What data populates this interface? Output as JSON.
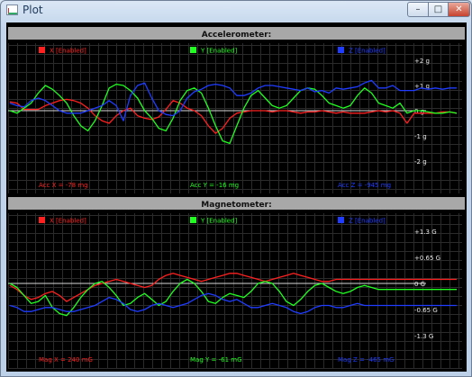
{
  "window": {
    "title": "Plot",
    "min_label": "–",
    "max_label": "□",
    "close_label": "✕"
  },
  "chart_data": [
    {
      "type": "line",
      "title": "Accelerometer:",
      "series": [
        {
          "name": "X [Enabled]",
          "color": "#ff2020",
          "values": [
            0.35,
            0.3,
            0.05,
            0.05,
            0.05,
            0.2,
            0.3,
            0.4,
            0.45,
            0.4,
            0.3,
            0.1,
            -0.2,
            -0.4,
            -0.5,
            -0.2,
            0.0,
            0.1,
            -0.2,
            -0.3,
            -0.35,
            -0.25,
            0.05,
            0.4,
            0.3,
            0.1,
            0.0,
            -0.2,
            -0.6,
            -0.9,
            -0.7,
            -0.3,
            -0.1,
            -0.05,
            0.0,
            0.0,
            0.0,
            -0.05,
            0.0,
            0.0,
            -0.05,
            -0.1,
            -0.05,
            -0.05,
            0.0,
            -0.05,
            -0.1,
            -0.05,
            -0.1,
            -0.1,
            -0.1,
            -0.05,
            0.0,
            -0.05,
            0.0,
            -0.1,
            -0.5,
            -0.1,
            -0.1,
            -0.1,
            -0.1,
            -0.05,
            -0.05,
            -0.1
          ]
        },
        {
          "name": "Y [Enabled]",
          "color": "#20ff20",
          "values": [
            0.0,
            -0.1,
            0.1,
            0.3,
            0.7,
            1.0,
            0.85,
            0.6,
            0.3,
            -0.2,
            -0.6,
            -0.8,
            -0.4,
            0.2,
            0.9,
            1.05,
            1.0,
            0.8,
            0.5,
            0.0,
            -0.3,
            -0.7,
            -0.8,
            -0.3,
            0.4,
            0.8,
            0.9,
            0.7,
            0.1,
            -0.6,
            -1.2,
            -1.3,
            -0.6,
            0.1,
            0.6,
            0.8,
            0.5,
            0.2,
            0.1,
            0.2,
            0.5,
            0.8,
            0.9,
            0.85,
            0.6,
            0.3,
            0.2,
            0.1,
            0.2,
            0.6,
            0.9,
            0.7,
            0.3,
            0.2,
            0.1,
            0.3,
            -0.1,
            0.0,
            0.0,
            -0.05,
            -0.1,
            -0.1,
            -0.05,
            -0.1
          ]
        },
        {
          "name": "Z [Enabled]",
          "color": "#1f3cff",
          "values": [
            0.3,
            0.2,
            0.15,
            0.4,
            0.5,
            0.4,
            0.2,
            0.0,
            -0.1,
            -0.1,
            -0.1,
            0.0,
            0.1,
            0.2,
            0.4,
            0.2,
            -0.4,
            0.6,
            1.0,
            1.1,
            0.5,
            0.0,
            -0.15,
            -0.2,
            0.0,
            0.5,
            0.75,
            0.85,
            1.0,
            1.05,
            1.0,
            0.9,
            0.6,
            0.6,
            0.7,
            0.9,
            1.0,
            1.0,
            0.95,
            0.9,
            0.85,
            0.8,
            0.9,
            0.75,
            0.8,
            0.7,
            0.9,
            0.85,
            0.9,
            0.95,
            1.1,
            1.2,
            0.9,
            0.9,
            1.0,
            0.8,
            0.8,
            0.8,
            0.9,
            0.85,
            0.9,
            0.85,
            0.9,
            0.9
          ]
        }
      ],
      "y_ticks": [
        "+2 g",
        "+1 g",
        "0 g",
        "-1 g",
        "-2 g"
      ],
      "ylim": [
        -2.6,
        2.6
      ],
      "readouts": [
        {
          "text": "Acc X = -78 mg",
          "color": "#ff2020"
        },
        {
          "text": "Acc Y = -16 mg",
          "color": "#20ff20"
        },
        {
          "text": "Acc Z = -945 mg",
          "color": "#1f3cff"
        }
      ],
      "grid": true,
      "legend": "top"
    },
    {
      "type": "line",
      "title": "Magnetometer:",
      "series": [
        {
          "name": "X [Enabled]",
          "color": "#ff2020",
          "values": [
            -0.05,
            -0.15,
            -0.3,
            -0.4,
            -0.35,
            -0.25,
            -0.2,
            -0.3,
            -0.45,
            -0.35,
            -0.25,
            -0.15,
            -0.05,
            0.0,
            0.05,
            0.1,
            0.05,
            0.0,
            -0.05,
            -0.1,
            -0.05,
            0.1,
            0.2,
            0.25,
            0.2,
            0.15,
            0.1,
            0.05,
            0.1,
            0.15,
            0.2,
            0.25,
            0.25,
            0.2,
            0.15,
            0.1,
            0.05,
            0.1,
            0.15,
            0.2,
            0.25,
            0.2,
            0.15,
            0.1,
            0.05,
            0.05,
            0.1,
            0.1,
            0.1,
            0.1,
            0.1,
            0.1,
            0.1,
            0.1,
            0.1,
            0.1,
            0.1,
            0.1,
            0.1,
            0.1,
            0.1,
            0.1,
            0.1,
            0.1
          ]
        },
        {
          "name": "Y [Enabled]",
          "color": "#20ff20",
          "values": [
            0.0,
            -0.1,
            -0.3,
            -0.5,
            -0.45,
            -0.3,
            -0.6,
            -0.75,
            -0.8,
            -0.6,
            -0.35,
            -0.15,
            0.0,
            0.05,
            -0.1,
            -0.3,
            -0.55,
            -0.5,
            -0.35,
            -0.25,
            -0.4,
            -0.55,
            -0.45,
            -0.2,
            0.0,
            0.1,
            0.0,
            -0.2,
            -0.45,
            -0.5,
            -0.35,
            -0.25,
            -0.3,
            -0.35,
            -0.2,
            0.0,
            0.05,
            0.0,
            -0.2,
            -0.45,
            -0.55,
            -0.4,
            -0.2,
            -0.05,
            0.0,
            -0.1,
            -0.2,
            -0.25,
            -0.2,
            -0.1,
            -0.05,
            -0.1,
            -0.15,
            -0.15,
            -0.15,
            -0.15,
            -0.15,
            -0.15,
            -0.15,
            -0.15,
            -0.15,
            -0.15,
            -0.15,
            -0.15
          ]
        },
        {
          "name": "Z [Enabled]",
          "color": "#1f3cff",
          "values": [
            -0.55,
            -0.6,
            -0.7,
            -0.7,
            -0.65,
            -0.6,
            -0.6,
            -0.65,
            -0.7,
            -0.7,
            -0.65,
            -0.6,
            -0.55,
            -0.45,
            -0.35,
            -0.4,
            -0.5,
            -0.65,
            -0.7,
            -0.65,
            -0.55,
            -0.5,
            -0.55,
            -0.6,
            -0.55,
            -0.5,
            -0.4,
            -0.3,
            -0.25,
            -0.3,
            -0.4,
            -0.45,
            -0.4,
            -0.5,
            -0.6,
            -0.6,
            -0.55,
            -0.5,
            -0.55,
            -0.6,
            -0.7,
            -0.75,
            -0.7,
            -0.6,
            -0.55,
            -0.55,
            -0.6,
            -0.6,
            -0.55,
            -0.5,
            -0.55,
            -0.55,
            -0.55,
            -0.55,
            -0.55,
            -0.55,
            -0.55,
            -0.55,
            -0.55,
            -0.55,
            -0.55,
            -0.55,
            -0.55,
            -0.55
          ]
        }
      ],
      "y_ticks": [
        "+1.3 G",
        "+0.65 G",
        "0 G",
        "-0.65 G",
        "-1.3 G"
      ],
      "ylim": [
        -1.69,
        1.69
      ],
      "readouts": [
        {
          "text": "Mag X = 240 mG",
          "color": "#ff2020"
        },
        {
          "text": "Mag Y = -61 mG",
          "color": "#20ff20"
        },
        {
          "text": "Mag Z = -465 mG",
          "color": "#1f3cff"
        }
      ],
      "grid": true,
      "legend": "top"
    }
  ]
}
